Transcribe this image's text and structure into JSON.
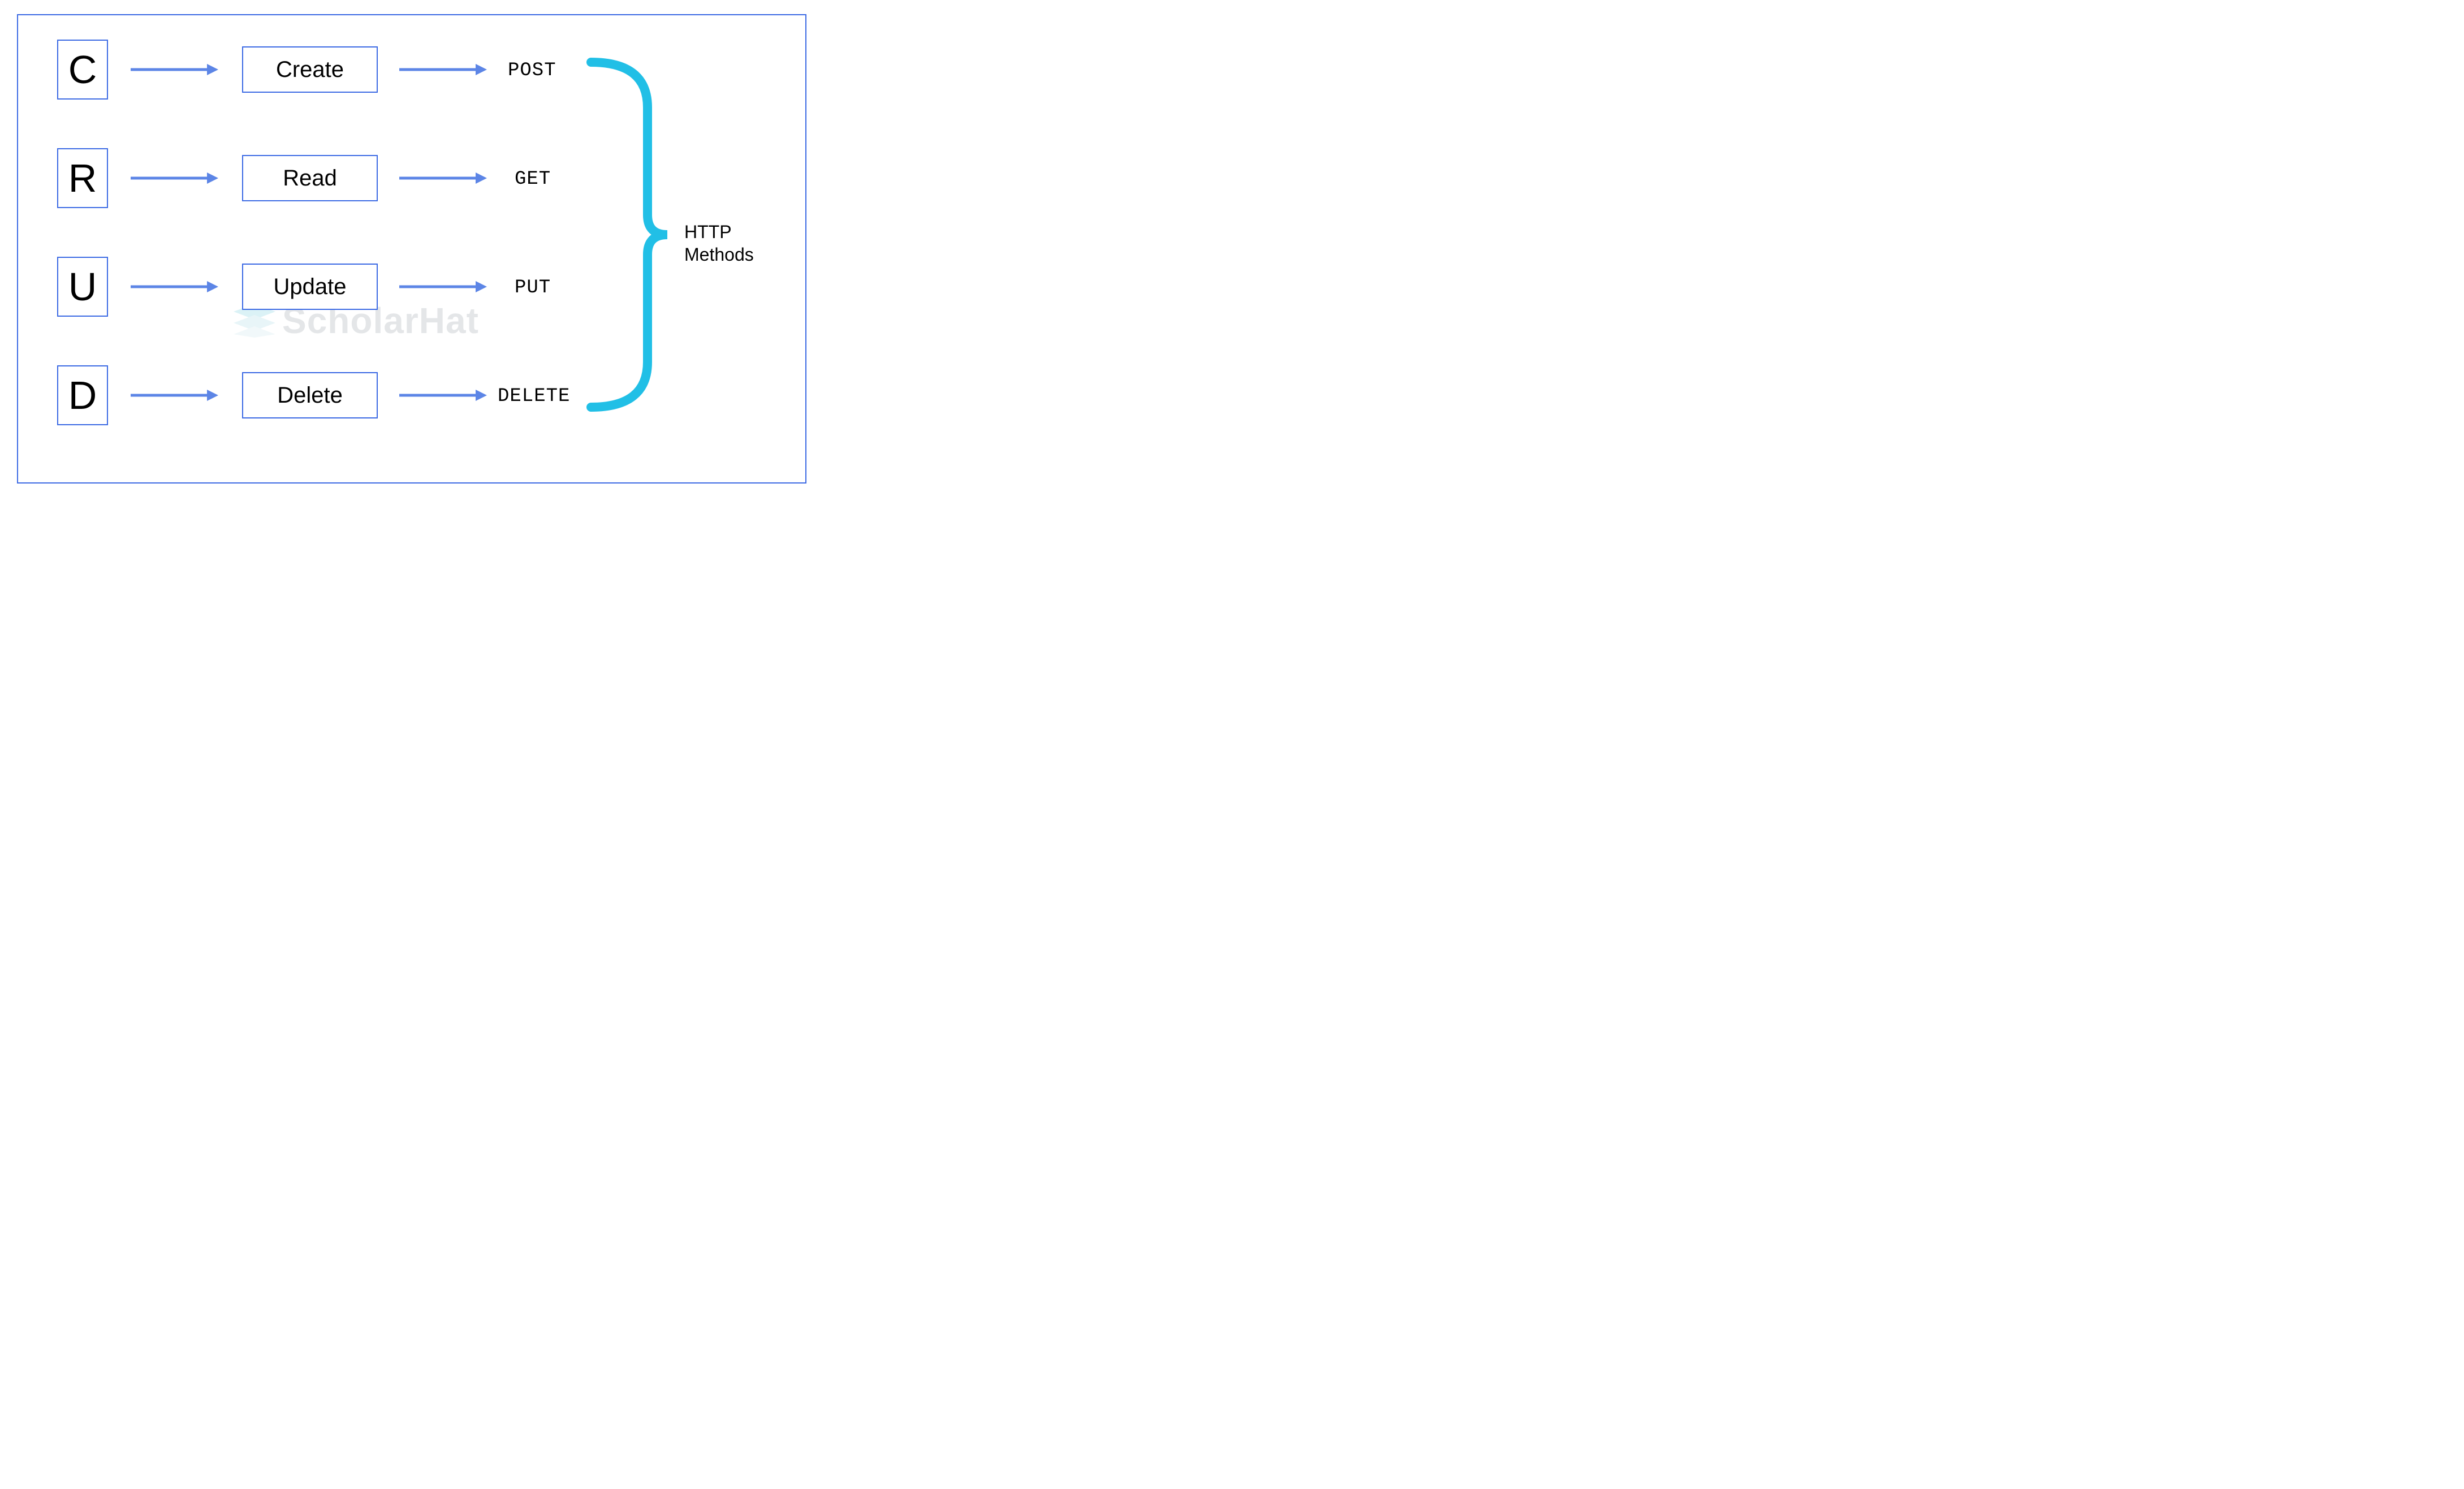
{
  "rows": [
    {
      "letter": "C",
      "operation": "Create",
      "method": "POST"
    },
    {
      "letter": "R",
      "operation": "Read",
      "method": "GET"
    },
    {
      "letter": "U",
      "operation": "Update",
      "method": "PUT"
    },
    {
      "letter": "D",
      "operation": "Delete",
      "method": "DELETE"
    }
  ],
  "group_label_line1": "HTTP",
  "group_label_line2": "Methods",
  "watermark": "ScholarHat",
  "colors": {
    "border": "#3d6be4",
    "arrow": "#5c85e6",
    "bracket": "#21bfe6"
  }
}
